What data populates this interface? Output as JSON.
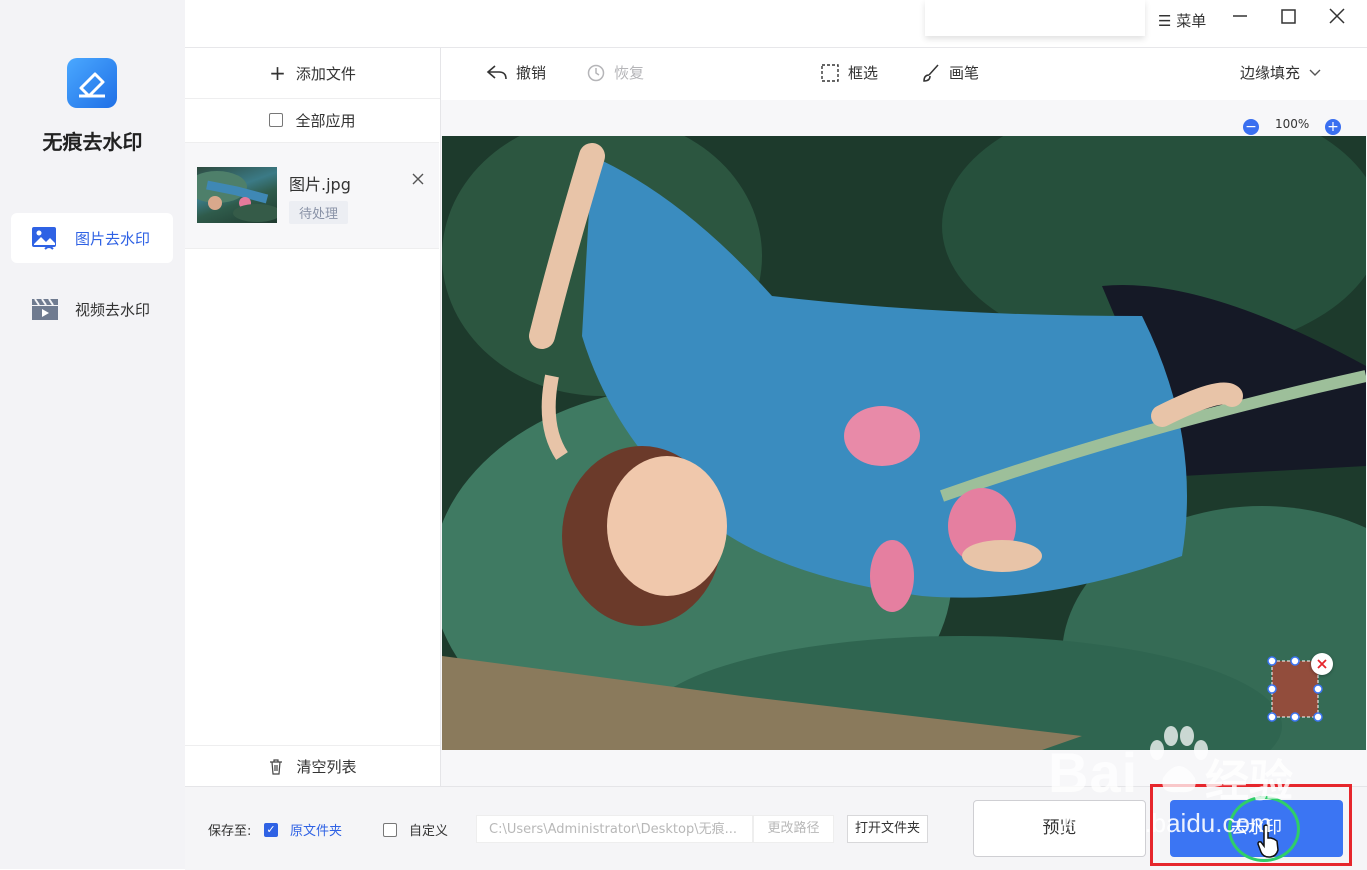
{
  "app": {
    "name": "无痕去水印",
    "menu_label": "菜单",
    "nav": [
      {
        "label": "图片去水印",
        "icon": "image-icon",
        "active": true
      },
      {
        "label": "视频去水印",
        "icon": "video-icon",
        "active": false
      }
    ]
  },
  "file_panel": {
    "add_file": "添加文件",
    "apply_all": "全部应用",
    "clear_list": "清空列表",
    "files": [
      {
        "name": "图片.jpg",
        "status": "待处理"
      }
    ]
  },
  "toolbar": {
    "undo": "撤销",
    "redo": "恢复",
    "box_select": "框选",
    "brush": "画笔",
    "fill_mode": "边缘填充"
  },
  "zoom": {
    "level": "100%"
  },
  "bottom": {
    "save_to": "保存至:",
    "source_folder": "原文件夹",
    "custom": "自定义",
    "path": "C:\\Users\\Administrator\\Desktop\\无痕...",
    "change_path": "更改路径",
    "open_folder": "打开文件夹",
    "preview": "预览",
    "remove": "去水印"
  },
  "overlay": {
    "watermark1": "Bai",
    "watermark2": "经验",
    "watermark3": "jingyan.baidu.com"
  },
  "colors": {
    "accent": "#3b75f3",
    "highlight": "#e6262c"
  }
}
